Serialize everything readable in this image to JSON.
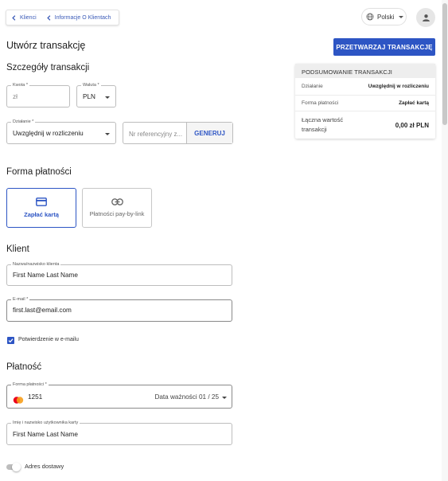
{
  "breadcrumb": {
    "items": [
      {
        "label": "Klienci"
      },
      {
        "label": "Informacje O Klientach"
      }
    ]
  },
  "header": {
    "language": "Polski",
    "page_title": "Utwórz transakcję",
    "process_button": "PRZETWARZAJ TRANSAKCJĘ"
  },
  "details": {
    "heading": "Szczegóły transakcji",
    "amount": {
      "label": "Kwota *",
      "placeholder": "zł"
    },
    "currency": {
      "label": "Waluta *",
      "value": "PLN"
    },
    "action": {
      "label": "Działanie *",
      "value": "Uwzględnij w rozliczeniu"
    },
    "reference": {
      "placeholder": "Nr referencyjny z...",
      "generate_button": "GENERUJ"
    }
  },
  "summary": {
    "heading": "PODSUMOWANIE TRANSAKCJI",
    "rows": [
      {
        "label": "Działanie",
        "value": "Uwzględnij w rozliczeniu"
      },
      {
        "label": "Forma płatności",
        "value": "Zapłać kartą"
      }
    ],
    "total_label": "Łączna wartość transakcji",
    "total_value": "0,00 zł PLN"
  },
  "payment_form": {
    "heading": "Forma płatności",
    "options": [
      {
        "label": "Zapłać kartą",
        "icon": "credit-card-icon",
        "selected": true
      },
      {
        "label": "Płatności pay-by-link",
        "icon": "link-icon",
        "selected": false
      }
    ]
  },
  "client": {
    "heading": "Klient",
    "name": {
      "label": "Nazwa/nazwisko klienta",
      "value": "First Name Last Name"
    },
    "email": {
      "label": "E-mail *",
      "value": "first.last@email.com"
    },
    "email_confirmation": {
      "label": "Potwierdzenie w e-mailu",
      "checked": true
    }
  },
  "payment": {
    "heading": "Płatność",
    "method": {
      "label": "Forma płatności *",
      "card_last4": "1251",
      "expiry": "Data ważności 01 / 25",
      "icon": "mastercard-icon"
    },
    "cardholder": {
      "label": "Imię i nazwisko użytkownika karty",
      "value": "First Name Last Name"
    },
    "shipping_address": {
      "label": "Adres dostawy",
      "enabled": false
    }
  },
  "colors": {
    "accent": "#2d55c4"
  }
}
